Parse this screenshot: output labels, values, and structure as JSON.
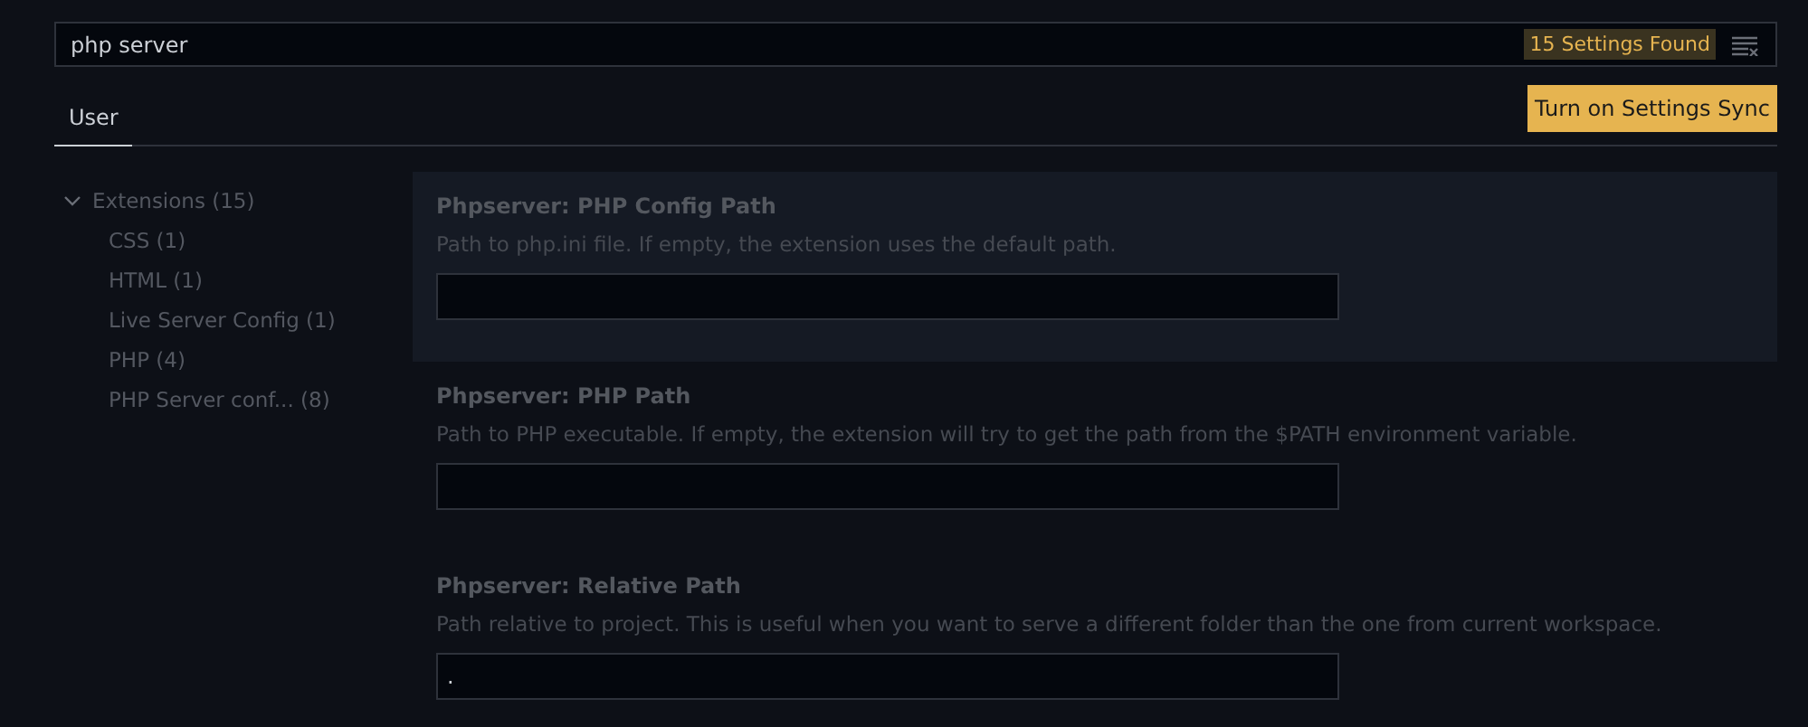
{
  "search": {
    "value": "php server",
    "result_count": "15 Settings Found"
  },
  "tabs": [
    {
      "label": "User",
      "selected": true
    }
  ],
  "sync_button": "Turn on Settings Sync",
  "toc": [
    {
      "label": "Extensions (15)",
      "expanded": true,
      "children": [
        {
          "label": "CSS (1)"
        },
        {
          "label": "HTML (1)"
        },
        {
          "label": "Live Server Config (1)"
        },
        {
          "label": "PHP (4)"
        },
        {
          "label": "PHP Server conf...  (8)"
        }
      ]
    }
  ],
  "settings": [
    {
      "title": "Phpserver: **PHP Config Path**",
      "description": "Path to php.ini file. If empty, the extension uses the default path.",
      "selected": true
    },
    {
      "title": "Phpserver: **PHP Path**",
      "description": "Path to PHP executable. If empty, the extension will try to get the path from the $PATH environment variable.",
      "selected": false
    },
    {
      "title": "Phpserver: **Relative Path**",
      "description": "Path relative to project. This is useful when you want to serve a different folder than the one from current workspace.",
      "value": ".",
      "selected": false
    }
  ]
}
